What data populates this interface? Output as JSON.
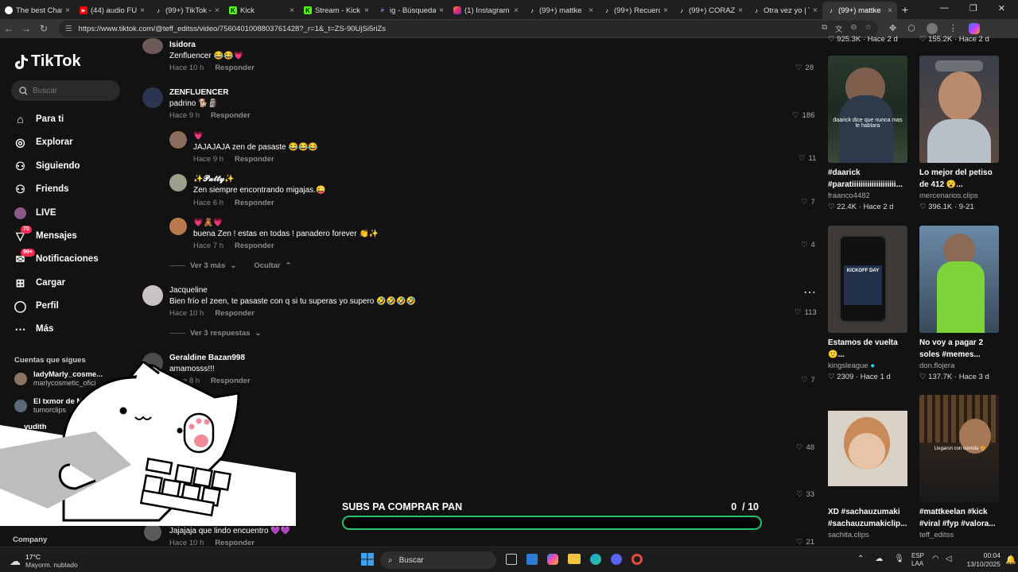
{
  "browser": {
    "tabs": [
      {
        "label": "The best Chat",
        "icon": "github-icon",
        "color": "#ffffff"
      },
      {
        "label": "(44) audio FU",
        "icon": "youtube-icon",
        "color": "#ff0000"
      },
      {
        "label": "(99+) TikTok -",
        "icon": "tiktok-icon",
        "color": "#ffffff"
      },
      {
        "label": "Kick",
        "icon": "kick-icon",
        "color": "#53fc18"
      },
      {
        "label": "Stream - Kick",
        "icon": "kick-icon",
        "color": "#53fc18"
      },
      {
        "label": "ig - Búsqueda",
        "icon": "search-icon",
        "color": "#8ab4f8"
      },
      {
        "label": "(1) Instagram",
        "icon": "instagram-icon",
        "color": "#e1306c"
      },
      {
        "label": "(99+) mattke",
        "icon": "tiktok-icon",
        "color": "#ffffff"
      },
      {
        "label": "(99+) Recuerd",
        "icon": "tiktok-icon",
        "color": "#ffffff"
      },
      {
        "label": "(99+) CORAZÓ",
        "icon": "tiktok-icon",
        "color": "#ffffff"
      },
      {
        "label": "Otra vez yo | T",
        "icon": "tiktok-icon",
        "color": "#ffffff"
      },
      {
        "label": "(99+) mattke",
        "icon": "tiktok-icon",
        "color": "#ffffff"
      }
    ],
    "url": "https://www.tiktok.com/@teff_editss/video/7560401008803761428?_r=1&_t=ZS-90UjSi5riZs"
  },
  "sidebar": {
    "logo": "TikTok",
    "search_placeholder": "Buscar",
    "items": [
      {
        "label": "Para ti",
        "icon": "home-icon"
      },
      {
        "label": "Explorar",
        "icon": "compass-icon"
      },
      {
        "label": "Siguiendo",
        "icon": "following-icon"
      },
      {
        "label": "Friends",
        "icon": "friends-icon"
      },
      {
        "label": "LIVE",
        "icon": "live-icon"
      },
      {
        "label": "Mensajes",
        "icon": "messages-icon",
        "badge": "70"
      },
      {
        "label": "Notificaciones",
        "icon": "notifications-icon",
        "badge": "99+"
      },
      {
        "label": "Cargar",
        "icon": "upload-icon"
      },
      {
        "label": "Perfil",
        "icon": "profile-icon"
      },
      {
        "label": "Más",
        "icon": "more-icon"
      }
    ],
    "following_header": "Cuentas que sigues",
    "following": [
      {
        "name": "ladyMarly_cosme...",
        "handle": "marlycosmetic_ofici"
      },
      {
        "name": "El txmor de M",
        "handle": "tumorclips"
      },
      {
        "name": "yudith",
        "handle": ""
      }
    ],
    "company": "Company"
  },
  "comments": {
    "items": [
      {
        "user": "Isidora",
        "text": "Zenfluencer 😂😂💗",
        "time": "Hace 10 h",
        "reply": "Responder",
        "likes": "28"
      },
      {
        "user": "ZENFLUENCER",
        "text": "padrino 🐕🗿",
        "time": "Hace 9 h",
        "reply": "Responder",
        "likes": "186"
      },
      {
        "user": "💗",
        "text": "JAJAJAJA zen de pasaste 😂😂😂",
        "time": "Hace 9 h",
        "reply": "Responder",
        "likes": "11"
      },
      {
        "user": "✨𝓟𝓪𝓽𝓽𝔂✨",
        "text": "Zen siempre encontrando migajas.😜",
        "time": "Hace 6 h",
        "reply": "Responder",
        "likes": "7"
      },
      {
        "user": "💗🧸💗",
        "text": "buena Zen ! estas en todas ! panadero forever 👏✨",
        "time": "Hace 7 h",
        "reply": "Responder",
        "likes": "4"
      },
      {
        "user": "Jacqueline",
        "text": "Bien frío el zeen, te pasaste con q si tu superas yo supero 🤣🤣🤣🤣",
        "time": "Hace 10 h",
        "reply": "Responder",
        "likes": "113"
      },
      {
        "user": "Geraldine Bazan998",
        "text": "amamosss!!!",
        "time": "Hace 8 h",
        "reply": "Responder",
        "likes": "7"
      },
      {
        "user": "",
        "text": "Jajajaja que lindo encuentro 💜💜",
        "time": "Hace 10 h",
        "reply": "Responder",
        "likes": "21"
      }
    ],
    "ver_mas": "Ver 3 más",
    "ocultar": "Ocultar",
    "ver_respuestas": "Ver 3 respuestas",
    "partial_likes_1": "48",
    "partial_likes_2": "33"
  },
  "videos": [
    {
      "caption1": "#daarick",
      "caption2": "#paratiiiiiiiiiiiiiiiiiiii...",
      "author": "fraanco4482",
      "views": "22.4K",
      "date": "Hace 2 d",
      "top_views": "925.3K",
      "top_date": "Hace 2 d",
      "thumb_text": "daarick dice que nunca mas le hablara"
    },
    {
      "caption1": "Lo mejor del petiso",
      "caption2": "de 412 😮...",
      "author": "mercenarios.clips",
      "views": "396.1K",
      "date": "9-21",
      "top_views": "155.2K",
      "top_date": "Hace 2 d"
    },
    {
      "caption1": "Estamos de vuelta",
      "caption2": "🙂...",
      "author": "kingsleague",
      "views": "2309",
      "date": "Hace 1 d",
      "thumb_text": "KICKOFF DAY"
    },
    {
      "caption1": "No voy a pagar 2",
      "caption2": "soles #memes...",
      "author": "don.flojera",
      "views": "137.7K",
      "date": "Hace 3 d"
    },
    {
      "caption1": "XD #sachauzumaki",
      "caption2": "#sachauzumakiclip...",
      "author": "sachita.clips",
      "views": "",
      "date": ""
    },
    {
      "caption1": "#mattkeelan #kick",
      "caption2": "#viral #fyp #valora...",
      "author": "teff_editss",
      "views": "",
      "date": "",
      "thumb_text": "Llegaron con comida 🍔"
    }
  ],
  "goal": {
    "title": "SUBS PA COMPRAR PAN",
    "current": "0",
    "target": "/ 10",
    "progress": 0
  },
  "taskbar": {
    "weather_temp": "17°C",
    "weather_desc": "Mayorm. nublado",
    "search": "Buscar",
    "lang1": "ESP",
    "lang2": "LAA",
    "time": "00:04",
    "date": "13/10/2025"
  },
  "colors": {
    "accent": "#fe2c55",
    "goal_bar": "#29c36a",
    "background": "#121212"
  }
}
